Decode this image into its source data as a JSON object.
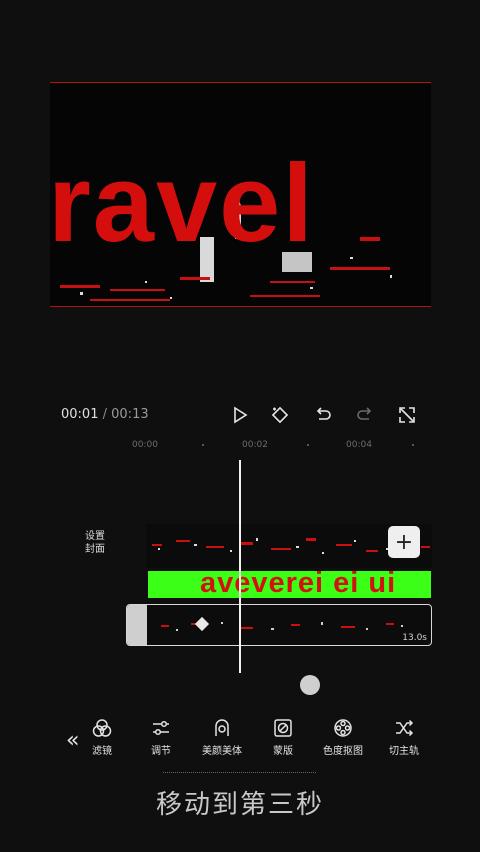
{
  "preview": {
    "overlay_text": "ravel"
  },
  "player": {
    "current_time": "00:01",
    "separator": "/",
    "total_time": "00:13"
  },
  "timeline": {
    "ruler": {
      "ticks": [
        "00:00",
        "00:02",
        "00:04"
      ]
    },
    "cover_label": "设置\n封面",
    "add_button": "+",
    "text_clip": "aveverei ei ui",
    "audio_duration": "13.0s"
  },
  "toolbar": {
    "collapse": "«",
    "items": [
      {
        "label": "滤镜",
        "icon": "filter-icon"
      },
      {
        "label": "调节",
        "icon": "adjust-icon"
      },
      {
        "label": "美颜美体",
        "icon": "beauty-icon"
      },
      {
        "label": "蒙版",
        "icon": "mask-icon"
      },
      {
        "label": "色度抠图",
        "icon": "chroma-key-icon"
      },
      {
        "label": "切主轨",
        "icon": "switch-track-icon"
      }
    ]
  },
  "subtitle": "移动到第三秒",
  "colors": {
    "accent_red": "#d40d0d",
    "green_screen": "#3bff16",
    "background": "#0f0f10"
  }
}
